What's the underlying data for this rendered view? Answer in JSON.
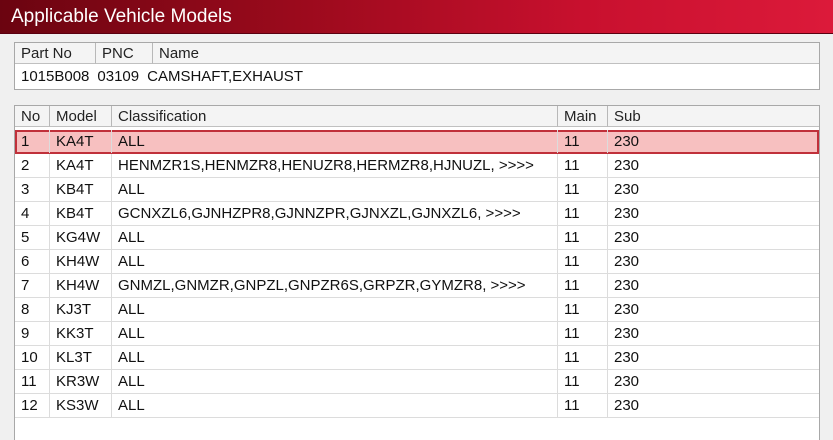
{
  "window": {
    "title": "Applicable Vehicle Models"
  },
  "part": {
    "headers": {
      "part_no": "Part No",
      "pnc": "PNC",
      "name": "Name"
    },
    "part_no": "1015B008",
    "pnc": "03109",
    "name": "CAMSHAFT,EXHAUST"
  },
  "table": {
    "headers": {
      "no": "No",
      "model": "Model",
      "classification": "Classification",
      "main": "Main",
      "sub": "Sub"
    },
    "selected_row": 0,
    "rows": [
      {
        "no": "1",
        "model": "KA4T",
        "classification": "ALL",
        "main": "11",
        "sub": "230"
      },
      {
        "no": "2",
        "model": "KA4T",
        "classification": "HENMZR1S,HENMZR8,HENUZR8,HERMZR8,HJNUZL,  >>>>",
        "main": "11",
        "sub": "230"
      },
      {
        "no": "3",
        "model": "KB4T",
        "classification": "ALL",
        "main": "11",
        "sub": "230"
      },
      {
        "no": "4",
        "model": "KB4T",
        "classification": "GCNXZL6,GJNHZPR8,GJNNZPR,GJNXZL,GJNXZL6,  >>>>",
        "main": "11",
        "sub": "230"
      },
      {
        "no": "5",
        "model": "KG4W",
        "classification": "ALL",
        "main": "11",
        "sub": "230"
      },
      {
        "no": "6",
        "model": "KH4W",
        "classification": "ALL",
        "main": "11",
        "sub": "230"
      },
      {
        "no": "7",
        "model": "KH4W",
        "classification": "GNMZL,GNMZR,GNPZL,GNPZR6S,GRPZR,GYMZR8,  >>>>",
        "main": "11",
        "sub": "230"
      },
      {
        "no": "8",
        "model": "KJ3T",
        "classification": "ALL",
        "main": "11",
        "sub": "230"
      },
      {
        "no": "9",
        "model": "KK3T",
        "classification": "ALL",
        "main": "11",
        "sub": "230"
      },
      {
        "no": "10",
        "model": "KL3T",
        "classification": "ALL",
        "main": "11",
        "sub": "230"
      },
      {
        "no": "11",
        "model": "KR3W",
        "classification": "ALL",
        "main": "11",
        "sub": "230"
      },
      {
        "no": "12",
        "model": "KS3W",
        "classification": "ALL",
        "main": "11",
        "sub": "230"
      }
    ]
  }
}
